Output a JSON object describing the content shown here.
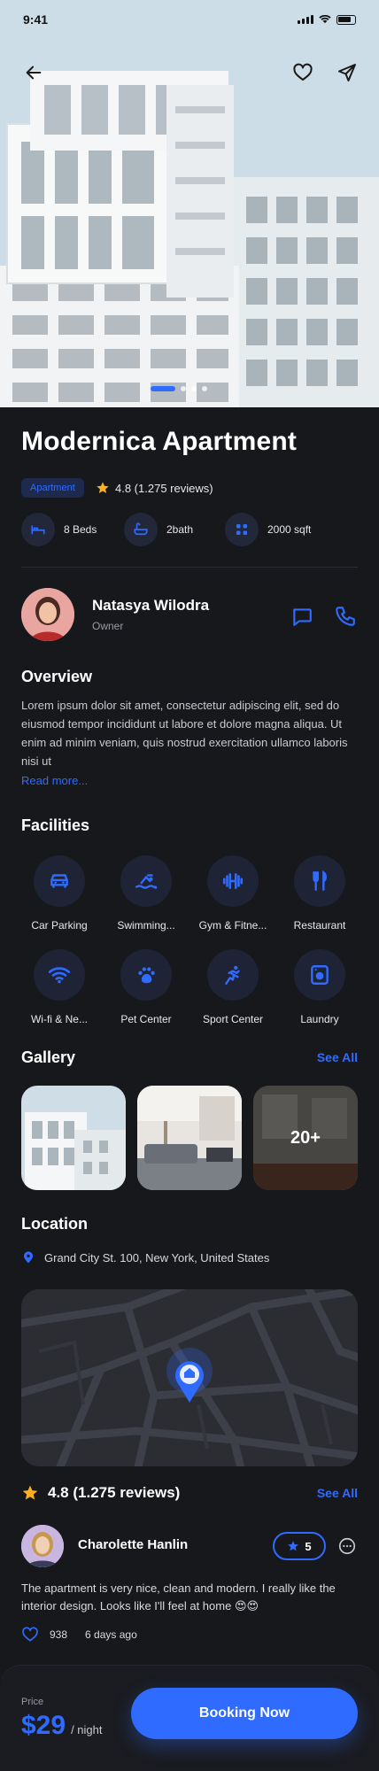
{
  "status_bar": {
    "time": "9:41"
  },
  "icons": {
    "back": "arrow-left-icon",
    "favorite": "heart-icon",
    "share": "send-icon",
    "star": "star-icon",
    "chat": "chat-icon",
    "call": "phone-icon",
    "location": "location-pin-icon",
    "more": "more-icon",
    "like": "heart-icon"
  },
  "carousel": {
    "count": 4,
    "active": 0
  },
  "property": {
    "title": "Modernica Apartment",
    "type": "Apartment",
    "rating": "4.8 (1.275 reviews)",
    "specs": [
      {
        "icon": "bed-icon",
        "label": "8 Beds"
      },
      {
        "icon": "bath-icon",
        "label": "2bath"
      },
      {
        "icon": "area-icon",
        "label": "2000 sqft"
      }
    ]
  },
  "agent": {
    "name": "Natasya Wilodra",
    "role": "Owner"
  },
  "overview": {
    "title": "Overview",
    "text": "Lorem ipsum dolor sit amet, consectetur adipiscing elit, sed do eiusmod tempor incididunt ut labore et dolore magna aliqua. Ut enim ad minim veniam, quis nostrud exercitation ullamco laboris nisi ut",
    "read_more": "Read more..."
  },
  "facilities": {
    "title": "Facilities",
    "items": [
      {
        "icon": "car-icon",
        "label": "Car Parking"
      },
      {
        "icon": "swimming-icon",
        "label": "Swimming..."
      },
      {
        "icon": "dumbbell-icon",
        "label": "Gym & Fitne..."
      },
      {
        "icon": "restaurant-icon",
        "label": "Restaurant"
      },
      {
        "icon": "wifi-icon",
        "label": "Wi-fi & Ne..."
      },
      {
        "icon": "pet-icon",
        "label": "Pet Center"
      },
      {
        "icon": "sport-icon",
        "label": "Sport Center"
      },
      {
        "icon": "laundry-icon",
        "label": "Laundry"
      }
    ]
  },
  "gallery": {
    "title": "Gallery",
    "see_all": "See All",
    "more_count": "20+"
  },
  "location": {
    "title": "Location",
    "address": "Grand City St. 100, New York, United States"
  },
  "reviews": {
    "summary": "4.8 (1.275 reviews)",
    "see_all": "See All",
    "items": [
      {
        "name": "Charolette Hanlin",
        "rating": "5",
        "text": "The apartment is very nice, clean and modern. I really like the interior design. Looks like I'll feel at home 😍😍",
        "likes": "938",
        "time": "6 days ago"
      }
    ]
  },
  "booking": {
    "price_label": "Price",
    "price": "$29",
    "unit": "/ night",
    "cta": "Booking Now"
  },
  "colors": {
    "accent": "#2f6bff",
    "background": "#17181c",
    "surface": "#1e2436"
  }
}
